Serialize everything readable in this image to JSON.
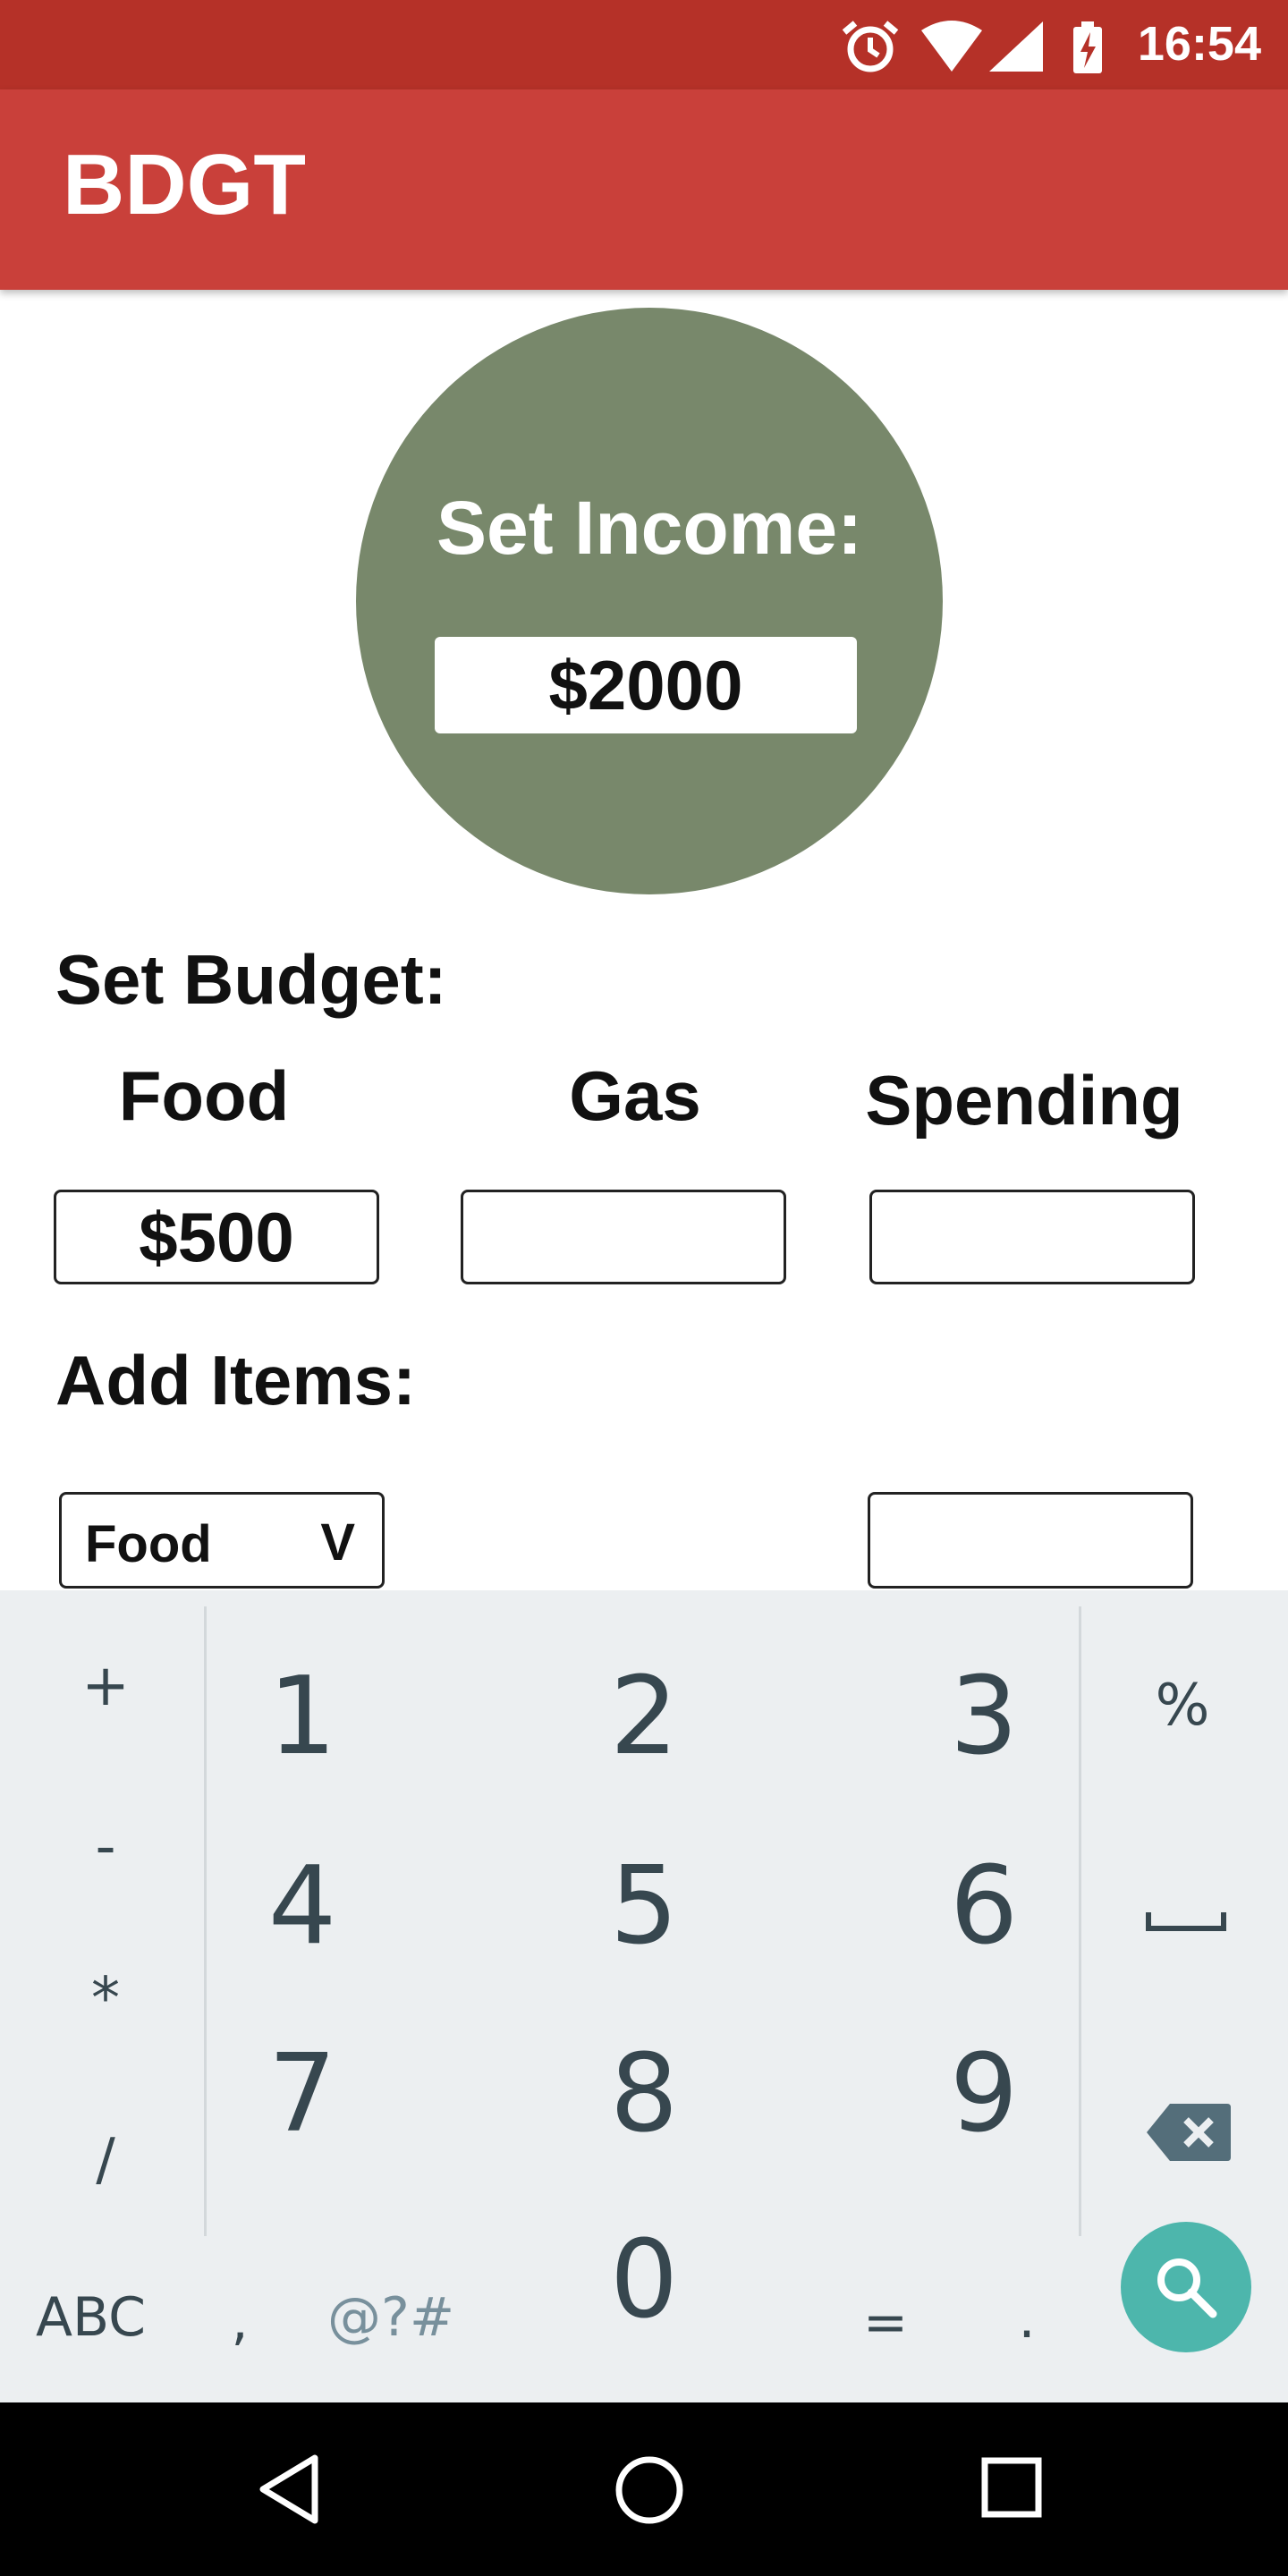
{
  "status_bar": {
    "time": "16:54"
  },
  "app_bar": {
    "title": "BDGT"
  },
  "income": {
    "label": "Set Income:",
    "value": "$2000"
  },
  "budget": {
    "title": "Set Budget:",
    "categories": [
      {
        "label": "Food",
        "value": "$500"
      },
      {
        "label": "Gas",
        "value": ""
      },
      {
        "label": "Spending",
        "value": ""
      }
    ]
  },
  "add_items": {
    "title": "Add Items:",
    "category_select": {
      "value": "Food",
      "arrow": "V"
    },
    "amount_value": ""
  },
  "keyboard": {
    "ops": [
      "+",
      "-",
      "*",
      "/"
    ],
    "digits": [
      "1",
      "2",
      "3",
      "4",
      "5",
      "6",
      "7",
      "8",
      "9",
      "0"
    ],
    "percent": "%",
    "abc": "ABC",
    "comma": ",",
    "symbols": "@?#",
    "equals": "=",
    "period": ".",
    "icons": {
      "space": "space-icon",
      "backspace": "backspace-icon",
      "search": "search-icon"
    }
  },
  "colors": {
    "status_bar": "#B53128",
    "app_bar": "#C9403A",
    "income_circle": "#78886B",
    "keyboard_bg": "#ECEFF1",
    "search_button": "#4DB6AC"
  }
}
